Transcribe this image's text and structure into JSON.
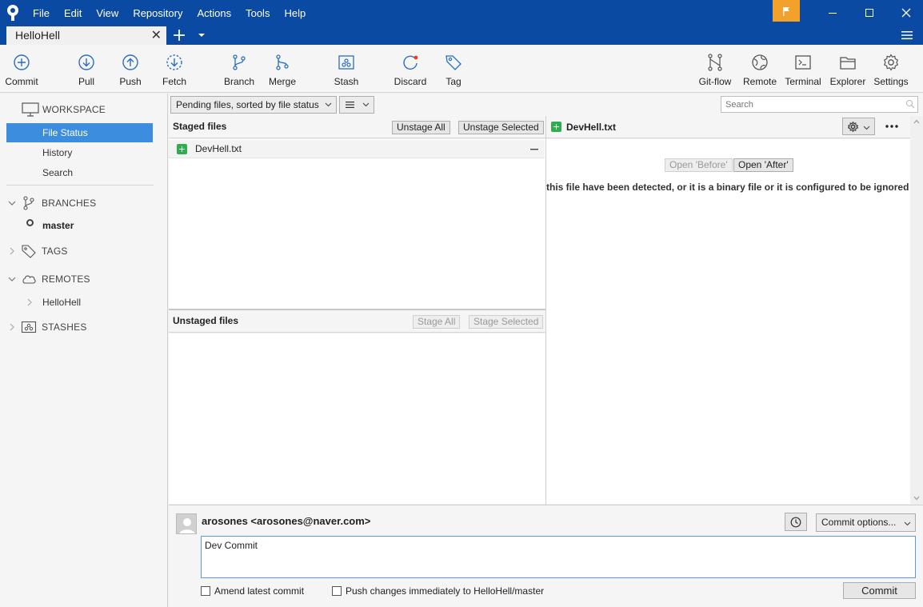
{
  "menu": [
    "File",
    "Edit",
    "View",
    "Repository",
    "Actions",
    "Tools",
    "Help"
  ],
  "tabs": {
    "active": "HelloHell"
  },
  "toolbar": {
    "commit": "Commit",
    "pull": "Pull",
    "push": "Push",
    "fetch": "Fetch",
    "branch": "Branch",
    "merge": "Merge",
    "stash": "Stash",
    "discard": "Discard",
    "tag": "Tag",
    "gitflow": "Git-flow",
    "remote": "Remote",
    "terminal": "Terminal",
    "explorer": "Explorer",
    "settings": "Settings"
  },
  "sidebar": {
    "workspace": "WORKSPACE",
    "items": [
      "File Status",
      "History",
      "Search"
    ],
    "branches": "BRANCHES",
    "current_branch": "master",
    "tags": "TAGS",
    "remotes": "REMOTES",
    "remote_name": "HelloHell",
    "stashes": "STASHES"
  },
  "filter": {
    "mode": "Pending files, sorted by file status",
    "view_icon": "list-icon",
    "search_placeholder": "Search"
  },
  "staged": {
    "title": "Staged files",
    "unstage_all": "Unstage All",
    "unstage_selected": "Unstage Selected",
    "files": [
      "DevHell.txt"
    ]
  },
  "unstaged": {
    "title": "Unstaged files",
    "stage_all": "Stage All",
    "stage_selected": "Stage Selected"
  },
  "diff": {
    "file": "DevHell.txt",
    "open_before": "Open 'Before'",
    "open_after": "Open 'After'",
    "message": "this file have been detected, or it is a binary file or it is configured to be ignored by t"
  },
  "commit": {
    "author": "arosones <arosones@naver.com>",
    "message": "Dev Commit",
    "options": "Commit options...",
    "amend": "Amend latest commit",
    "push_immediately": "Push changes immediately to HelloHell/master",
    "button": "Commit"
  },
  "colors": {
    "titlebar": "#0b4aa2",
    "selection": "#3c8ddd",
    "flag": "#f2a12a",
    "added": "#2fae4f",
    "toolbar_icon": "#2a6ec0"
  }
}
